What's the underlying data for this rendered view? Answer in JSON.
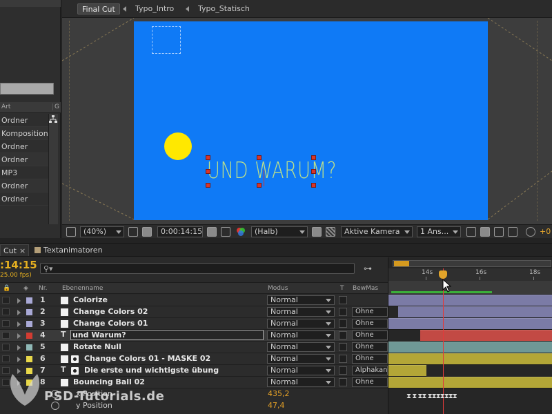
{
  "project": {
    "column_headers": {
      "type": "Art",
      "flow": "G"
    },
    "items": [
      "Ordner",
      "Komposition",
      "Ordner",
      "Ordner",
      "MP3",
      "Ordner",
      "Ordner"
    ]
  },
  "viewer": {
    "tabs": [
      "Final Cut",
      "Typo_Intro",
      "Typo_Statisch"
    ],
    "text_layer": "UND WARUM?",
    "toolbar": {
      "zoom": "(40%)",
      "timecode": "0:00:14:15",
      "resolution": "(Halb)",
      "camera": "Aktive Kamera",
      "views": "1 Ans...",
      "exposure": "+0"
    },
    "colors": {
      "background": "#0f7af6",
      "ball": "#ffe800",
      "text": "#bde08a"
    }
  },
  "timeline": {
    "tabs": {
      "active": "Cut",
      "other": "Textanimatoren",
      "close": "×"
    },
    "timecode": ":14:15",
    "fps": "25.00 fps)",
    "column_headers": {
      "nr": "Nr.",
      "name": "Ebenenname",
      "mode": "Modus",
      "t": "T",
      "bewmas": "BewMas"
    },
    "ruler": [
      "14s",
      "16s",
      "18s"
    ],
    "layers": [
      {
        "nr": "1",
        "name": "Colorize",
        "mode": "Normal",
        "bewmas": "",
        "label": "#a9a9d6",
        "icon": "solid",
        "bar_color": "#7b7ba6",
        "bar_start": 0
      },
      {
        "nr": "2",
        "name": "Change Colors 02",
        "mode": "Normal",
        "bewmas": "Ohne",
        "label": "#a9a9d6",
        "icon": "solid",
        "bar_color": "#7b7ba6",
        "bar_start": 14
      },
      {
        "nr": "3",
        "name": "Change Colors 01",
        "mode": "Normal",
        "bewmas": "Ohne",
        "label": "#a9a9d6",
        "icon": "solid",
        "bar_color": "#7b7ba6",
        "bar_start": 0
      },
      {
        "nr": "4",
        "name": "und Warum?",
        "mode": "Normal",
        "bewmas": "Ohne",
        "label": "#d23c32",
        "icon": "text",
        "bar_color": "#c24a44",
        "bar_start": 46,
        "selected": true
      },
      {
        "nr": "5",
        "name": "Rotate Null",
        "mode": "Normal",
        "bewmas": "Ohne",
        "label": "#8fb8b6",
        "icon": "solid",
        "bar_color": "#6f9896",
        "bar_start": 0
      },
      {
        "nr": "6",
        "name": "Change Colors 01 - MASKE 02",
        "mode": "Normal",
        "bewmas": "Ohne",
        "label": "#e8d84a",
        "icon": "solid-mask",
        "bar_color": "#b3a637",
        "bar_start": 0
      },
      {
        "nr": "7",
        "name": "Die erste und wichtigste übung",
        "mode": "Normal",
        "bewmas": "Alphakan",
        "label": "#e8d84a",
        "icon": "text-mask",
        "bar_color": "#b3a637",
        "bar_start": 0,
        "bar_end": 55
      },
      {
        "nr": "8",
        "name": "Bouncing Ball 02",
        "mode": "Normal",
        "bewmas": "Ohne",
        "label": "#e8d84a",
        "icon": "solid",
        "bar_color": "#b3a637",
        "bar_start": 0
      }
    ],
    "properties": [
      {
        "name": "x Position",
        "value": "435,2"
      },
      {
        "name": "y Position",
        "value": "47,4"
      }
    ]
  },
  "watermark": "PSD-Tutorials.de"
}
